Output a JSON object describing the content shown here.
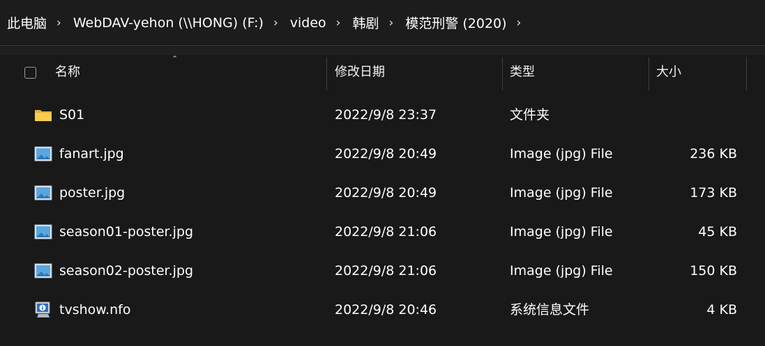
{
  "breadcrumb": [
    "此电脑",
    "WebDAV-yehon (\\\\HONG) (F:)",
    "video",
    "韩剧",
    "模范刑警 (2020)"
  ],
  "breadcrumb_separator": "›",
  "columns": {
    "name": "名称",
    "date": "修改日期",
    "type": "类型",
    "size": "大小"
  },
  "files": [
    {
      "icon": "folder-icon",
      "name": "S01",
      "date": "2022/9/8 23:37",
      "type": "文件夹",
      "size": ""
    },
    {
      "icon": "image-file-icon",
      "name": "fanart.jpg",
      "date": "2022/9/8 20:49",
      "type": "Image (jpg) File",
      "size": "236 KB"
    },
    {
      "icon": "image-file-icon",
      "name": "poster.jpg",
      "date": "2022/9/8 20:49",
      "type": "Image (jpg) File",
      "size": "173 KB"
    },
    {
      "icon": "image-file-icon",
      "name": "season01-poster.jpg",
      "date": "2022/9/8 21:06",
      "type": "Image (jpg) File",
      "size": "45 KB"
    },
    {
      "icon": "image-file-icon",
      "name": "season02-poster.jpg",
      "date": "2022/9/8 21:06",
      "type": "Image (jpg) File",
      "size": "150 KB"
    },
    {
      "icon": "info-file-icon",
      "name": "tvshow.nfo",
      "date": "2022/9/8 20:46",
      "type": "系统信息文件",
      "size": "4 KB"
    }
  ],
  "colors": {
    "background": "#191919",
    "text": "#ffffff",
    "folder": "#f5c445",
    "image_icon": "#4a9fd8"
  }
}
